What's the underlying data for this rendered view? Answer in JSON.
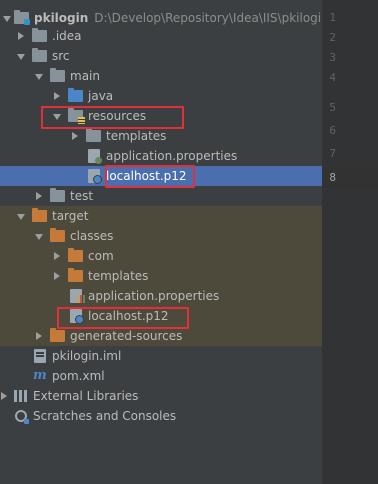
{
  "project_tree": {
    "items": [
      {
        "label": "pkilogin",
        "path": "D:\\Develop\\Repository\\Idea\\IIS\\pkilogin"
      },
      {
        "label": ".idea"
      },
      {
        "label": "src"
      },
      {
        "label": "main"
      },
      {
        "label": "java"
      },
      {
        "label": "resources"
      },
      {
        "label": "templates"
      },
      {
        "label": "application.properties"
      },
      {
        "label": "localhost.p12"
      },
      {
        "label": "test"
      },
      {
        "label": "target"
      },
      {
        "label": "classes"
      },
      {
        "label": "com"
      },
      {
        "label": "templates"
      },
      {
        "label": "application.properties"
      },
      {
        "label": "localhost.p12"
      },
      {
        "label": "generated-sources"
      },
      {
        "label": "pkilogin.iml"
      },
      {
        "label": "pom.xml"
      },
      {
        "label": "External Libraries"
      },
      {
        "label": "Scratches and Consoles"
      }
    ]
  },
  "editor": {
    "line_numbers": [
      "1",
      "2",
      "3",
      "4",
      "5",
      "6",
      "7",
      "8"
    ],
    "current_line": "8"
  },
  "colors": {
    "selection": "#4b6eaf",
    "excluded_background": "#4d4a3b",
    "highlight_box": "#e0313b"
  }
}
